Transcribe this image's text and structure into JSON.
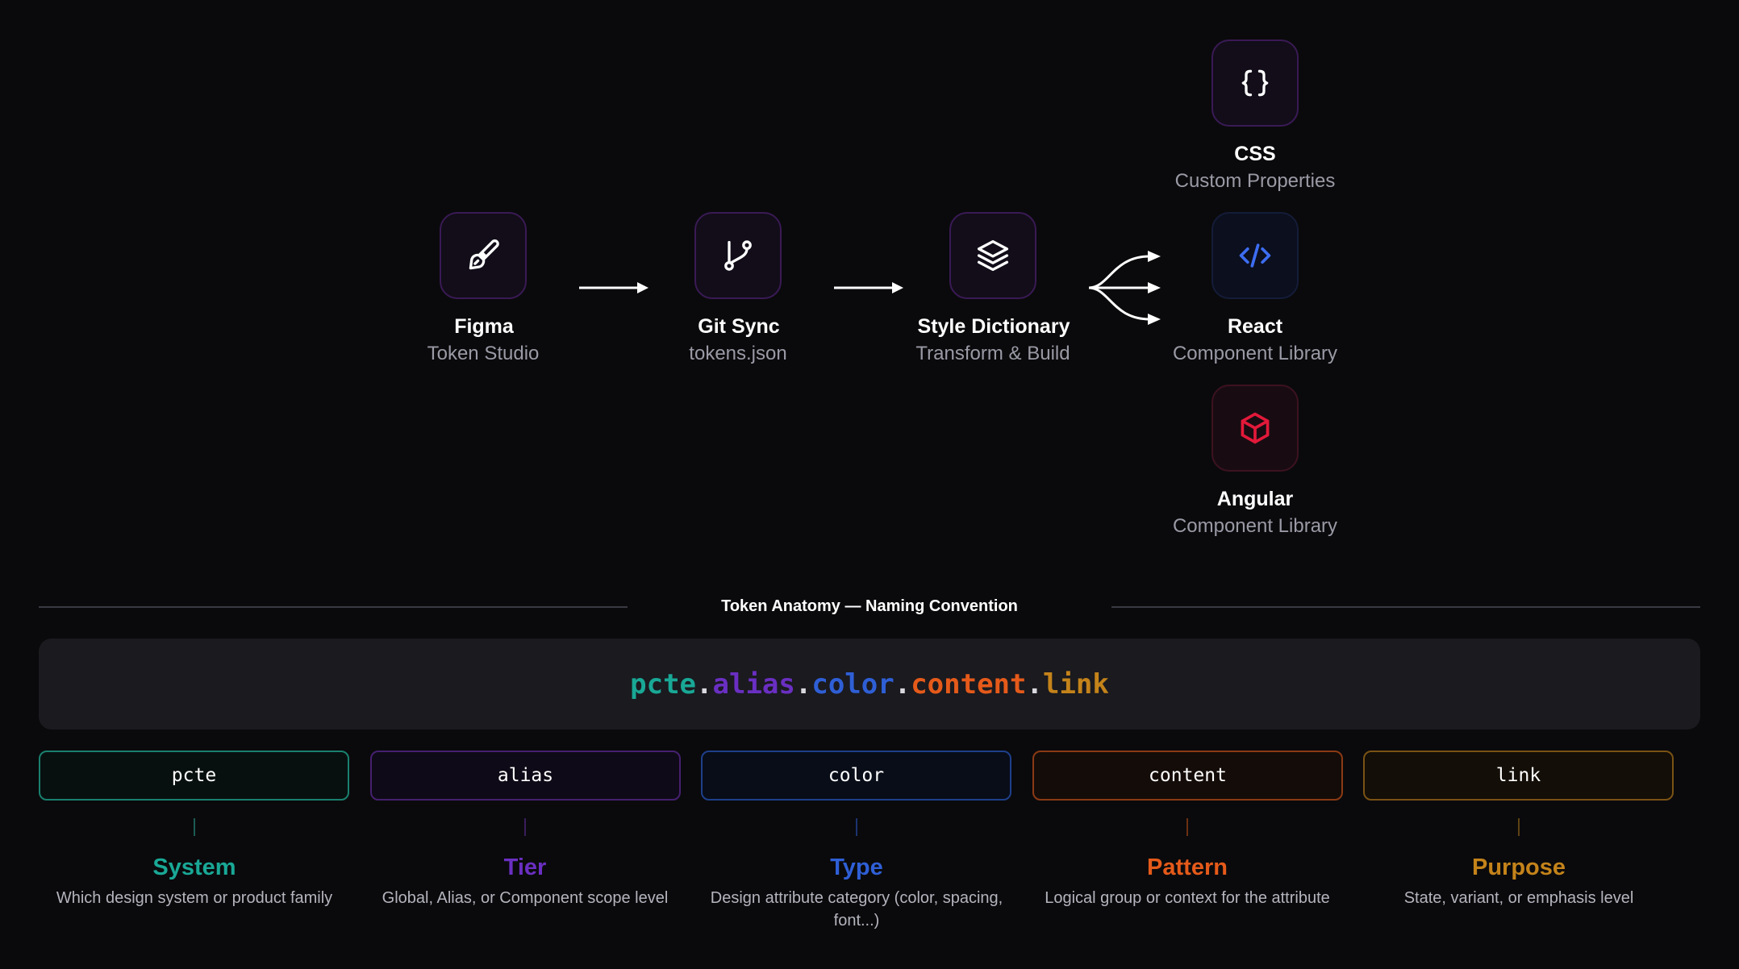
{
  "pipeline": {
    "figma": {
      "title": "Figma",
      "subtitle": "Token Studio",
      "icon": "paintbrush-icon"
    },
    "git": {
      "title": "Git Sync",
      "subtitle": "tokens.json",
      "icon": "git-branch-icon"
    },
    "style_dictionary": {
      "title": "Style Dictionary",
      "subtitle": "Transform & Build",
      "icon": "layers-icon"
    },
    "outputs": [
      {
        "title": "CSS",
        "subtitle": "Custom Properties",
        "icon": "braces-icon"
      },
      {
        "title": "React",
        "subtitle": "Component Library",
        "icon": "code-icon"
      },
      {
        "title": "Angular",
        "subtitle": "Component Library",
        "icon": "cube-icon"
      }
    ]
  },
  "anatomy": {
    "heading": "Token Anatomy — Naming Convention",
    "token": {
      "parts": [
        "pcte",
        "alias",
        "color",
        "content",
        "link"
      ],
      "separator": "."
    },
    "segments": [
      {
        "code": "pcte",
        "label": "System",
        "description": "Which design system or product family",
        "color": "#19a896"
      },
      {
        "code": "alias",
        "label": "Tier",
        "description": "Global, Alias, or Component scope level",
        "color": "#6a2fc2"
      },
      {
        "code": "color",
        "label": "Type",
        "description": "Design attribute category (color, spacing, font...)",
        "color": "#2f5fd6"
      },
      {
        "code": "content",
        "label": "Pattern",
        "description": "Logical group or context for the attribute",
        "color": "#e55a1a"
      },
      {
        "code": "link",
        "label": "Purpose",
        "description": "State, variant, or emphasis level",
        "color": "#c4831a"
      }
    ]
  },
  "colors": {
    "background": "#0a0a0c",
    "node_border": "#3a1a55",
    "react_accent": "#3d6df2",
    "angular_accent": "#e3193a"
  }
}
